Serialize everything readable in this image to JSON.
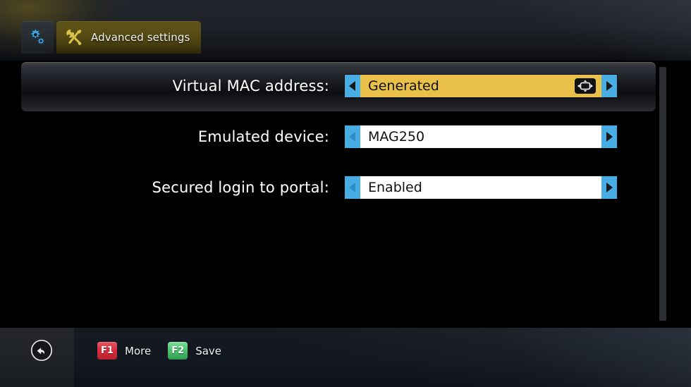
{
  "window": {
    "title": "Advanced settings"
  },
  "tabs": [
    {
      "id": "system",
      "icon": "gears-icon",
      "label": "",
      "active": false
    },
    {
      "id": "advanced",
      "icon": "tools-icon",
      "label": "Advanced settings",
      "active": true
    }
  ],
  "settings": {
    "rows": [
      {
        "id": "virtual-mac-address",
        "label": "Virtual MAC address:",
        "value": "Generated",
        "selected": true,
        "badge_icon": "dpad-screen-icon",
        "left_arrow_icon": "chevron-left-icon",
        "right_arrow_icon": "chevron-right-icon"
      },
      {
        "id": "emulated-device",
        "label": "Emulated device:",
        "value": "MAG250",
        "selected": false,
        "badge_icon": "",
        "left_arrow_icon": "chevron-left-icon",
        "right_arrow_icon": "chevron-right-icon"
      },
      {
        "id": "secured-login-to-portal",
        "label": "Secured login to portal:",
        "value": "Enabled",
        "selected": false,
        "badge_icon": "",
        "left_arrow_icon": "chevron-left-icon",
        "right_arrow_icon": "chevron-right-icon"
      }
    ]
  },
  "statusbar": {
    "back_icon": "back-arrow-circle-icon",
    "keys": [
      {
        "cap": "F1",
        "label": "More",
        "color": "#d8303f"
      },
      {
        "cap": "F2",
        "label": "Save",
        "color": "#4fc472"
      }
    ]
  },
  "colors": {
    "accent_blue": "#47ade3",
    "highlight_gold": "#e8c04a",
    "tab_active": "#574c14",
    "field_white": "#ffffff",
    "scrollbar": "#2b2d31"
  }
}
